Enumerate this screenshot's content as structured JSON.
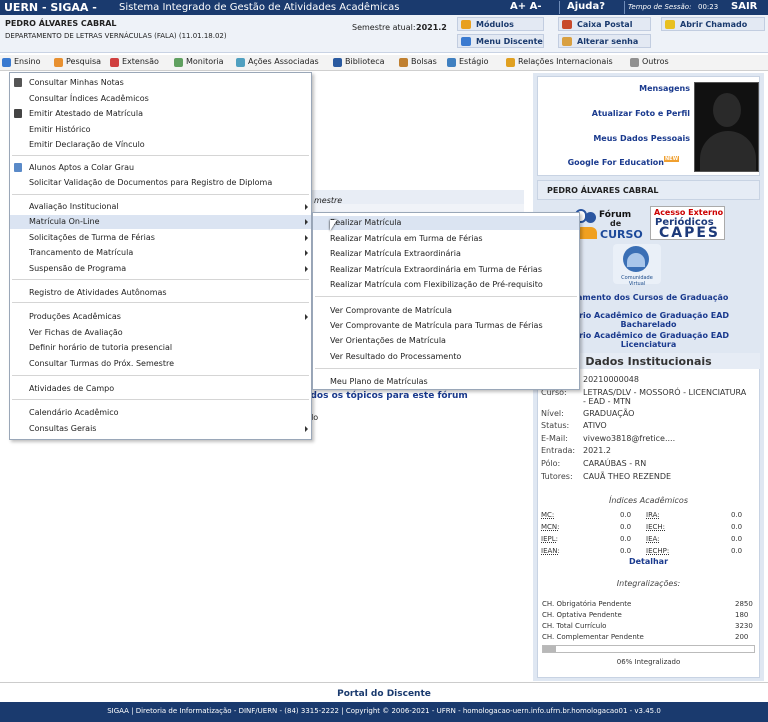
{
  "topbar": {
    "brand": "UERN - SIGAA -",
    "system_name": "Sistema Integrado de Gestão de Atividades Acadêmicas",
    "font_size_controls": "A+ A-",
    "help": "Ajuda?",
    "session_label": "Tempo de Sessão:",
    "session_time": "00:23",
    "logout": "SAIR"
  },
  "user_info": {
    "name": "PEDRO ÁLVARES CABRAL",
    "department": "DEPARTAMENTO DE LETRAS VERNÁCULAS (FALA) (11.01.18.02)",
    "semester_label": "Semestre atual:",
    "semester_value": "2021.2"
  },
  "quick_links": {
    "modules": "Módulos",
    "student_menu": "Menu Discente",
    "mailbox": "Caixa Postal",
    "change_password": "Alterar senha",
    "open_ticket": "Abrir Chamado"
  },
  "main_menu": [
    "Ensino",
    "Pesquisa",
    "Extensão",
    "Monitoria",
    "Ações Associadas",
    "Biblioteca",
    "Bolsas",
    "Estágio",
    "Relações Internacionais",
    "Outros"
  ],
  "ensino_menu": {
    "items": [
      "Consultar Minhas Notas",
      "Consultar Índices Acadêmicos",
      "Emitir Atestado de Matrícula",
      "Emitir Histórico",
      "Emitir Declaração de Vínculo",
      "Alunos Aptos a Colar Grau",
      "Solicitar Validação de Documentos para Registro de Diploma",
      "Avaliação Institucional",
      "Matrícula On-Line",
      "Solicitações de Turma de Férias",
      "Trancamento de Matrícula",
      "Suspensão de Programa",
      "Registro de Atividades Autônomas",
      "Produções Acadêmicas",
      "Ver Fichas de Avaliação",
      "Definir horário de tutoria presencial",
      "Consultar Turmas do Próx. Semestre",
      "Atividades de Campo",
      "Calendário Acadêmico",
      "Consultas Gerais"
    ]
  },
  "matricula_submenu": {
    "items": [
      "Realizar Matrícula",
      "Realizar Matrícula em Turma de Férias",
      "Realizar Matrícula Extraordinária",
      "Realizar Matrícula Extraordinária em Turma de Férias",
      "Realizar Matrícula com Flexibilização de Pré-requisito",
      "Ver Comprovante de Matrícula",
      "Ver Comprovante de Matrícula para Turmas de Férias",
      "Ver Orientações de Matrícula",
      "Ver Resultado do Processamento",
      "Meu Plano de Matrículas"
    ]
  },
  "background_fragments": {
    "semestre": "mestre",
    "forum_all": "todos os tópicos para este fórum",
    "rado": "rado"
  },
  "profile_links": {
    "messages": "Mensagens",
    "update_photo": "Atualizar Foto e Perfil",
    "my_data": "Meus Dados Pessoais",
    "google": "Google For Education",
    "google_badge": "NEW"
  },
  "profile_name": "PEDRO ÁLVARES CABRAL",
  "banners": {
    "forum_line1": "Fórum",
    "forum_line2": "de",
    "forum_line3": "CURSO",
    "capes_line1": "Acesso Externo",
    "capes_line2": "Periódicos",
    "capes_line3": "CAPES",
    "virtual_community": "Comunidade Virtual"
  },
  "right_links": {
    "regulation": "ulamento dos Cursos de Graduação",
    "cal_bach_1": "dário Acadêmico de Graduação EAD",
    "cal_bach_2": "Bacharelado",
    "cal_lic_1": "dário Acadêmico de Graduação EAD",
    "cal_lic_2": "Licenciatura"
  },
  "institutional": {
    "title": "Dados Institucionais",
    "registration": "20210000048",
    "course_label": "Curso:",
    "course_value_1": "LETRAS/DLV - MOSSORÓ - LICENCIATURA",
    "course_value_2": "- EAD - MTN",
    "level_label": "Nível:",
    "level_value": "GRADUAÇÃO",
    "status_label": "Status:",
    "status_value": "ATIVO",
    "email_label": "E-Mail:",
    "email_value": "vivewo3818@fretice....",
    "entry_label": "Entrada:",
    "entry_value": "2021.2",
    "pole_label": "Pólo:",
    "pole_value": "CARAÚBAS - RN",
    "tutors_label": "Tutores:",
    "tutors_value": "CAUÃ THEO REZENDE"
  },
  "indices": {
    "title": "Índices Acadêmicos",
    "rows": [
      {
        "l1": "MC:",
        "v1": "0.0",
        "l2": "IRA:",
        "v2": "0.0"
      },
      {
        "l1": "MCN:",
        "v1": "0.0",
        "l2": "IECH:",
        "v2": "0.0"
      },
      {
        "l1": "IEPL:",
        "v1": "0.0",
        "l2": "IEA:",
        "v2": "0.0"
      },
      {
        "l1": "IEAN:",
        "v1": "0.0",
        "l2": "IECHP:",
        "v2": "0.0"
      }
    ],
    "details": "Detalhar"
  },
  "integralizacoes": {
    "title": "Integralizações:",
    "rows": [
      {
        "label": "CH. Obrigatória Pendente",
        "value": "2850"
      },
      {
        "label": "CH. Optativa Pendente",
        "value": "180"
      },
      {
        "label": "CH. Total Currículo",
        "value": "3230"
      },
      {
        "label": "CH. Complementar Pendente",
        "value": "200"
      }
    ],
    "progress_percent": 6,
    "progress_label": "06% Integralizado"
  },
  "footer": {
    "portal": "Portal do Discente",
    "text": "SIGAA | Diretoria de Informatização - DINF/UERN - (84) 3315-2222 | Copyright © 2006-2021 - UFRN - homologacao-uern.info.ufrn.br.homologacao01 - v3.45.0"
  },
  "colors": {
    "header_blue": "#1a3a6e",
    "link_blue": "#1a3a8e",
    "panel_bg": "#dfe7f2",
    "highlight": "#dbe4f2"
  }
}
